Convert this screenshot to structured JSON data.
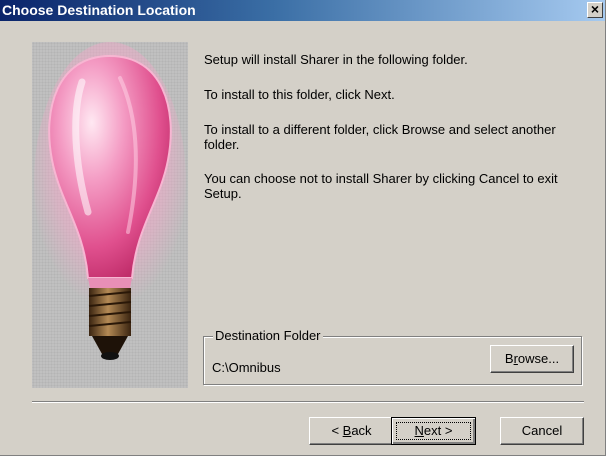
{
  "dialog": {
    "title": "Choose Destination Location",
    "close_glyph": "×"
  },
  "image": {
    "icon": "lightbulb-icon"
  },
  "messages": [
    "Setup will install Sharer in the following folder.",
    "To install to this folder, click Next.",
    "To install to a different folder, click Browse and select another folder.",
    "You can choose not to install Sharer by clicking Cancel to exit Setup."
  ],
  "destination": {
    "group_label": "Destination Folder",
    "path": "C:\\Omnibus",
    "browse": {
      "prefix": "B",
      "accel": "r",
      "suffix": "owse..."
    }
  },
  "buttons": {
    "back": {
      "prefix": "< ",
      "accel": "B",
      "suffix": "ack"
    },
    "next": {
      "accel": "N",
      "suffix": "ext >"
    },
    "cancel": "Cancel"
  },
  "colors": {
    "face": "#d4d0c8",
    "title_start": "#0a246a",
    "title_end": "#a6caf0",
    "bulb_glow": "#f07ab0"
  }
}
